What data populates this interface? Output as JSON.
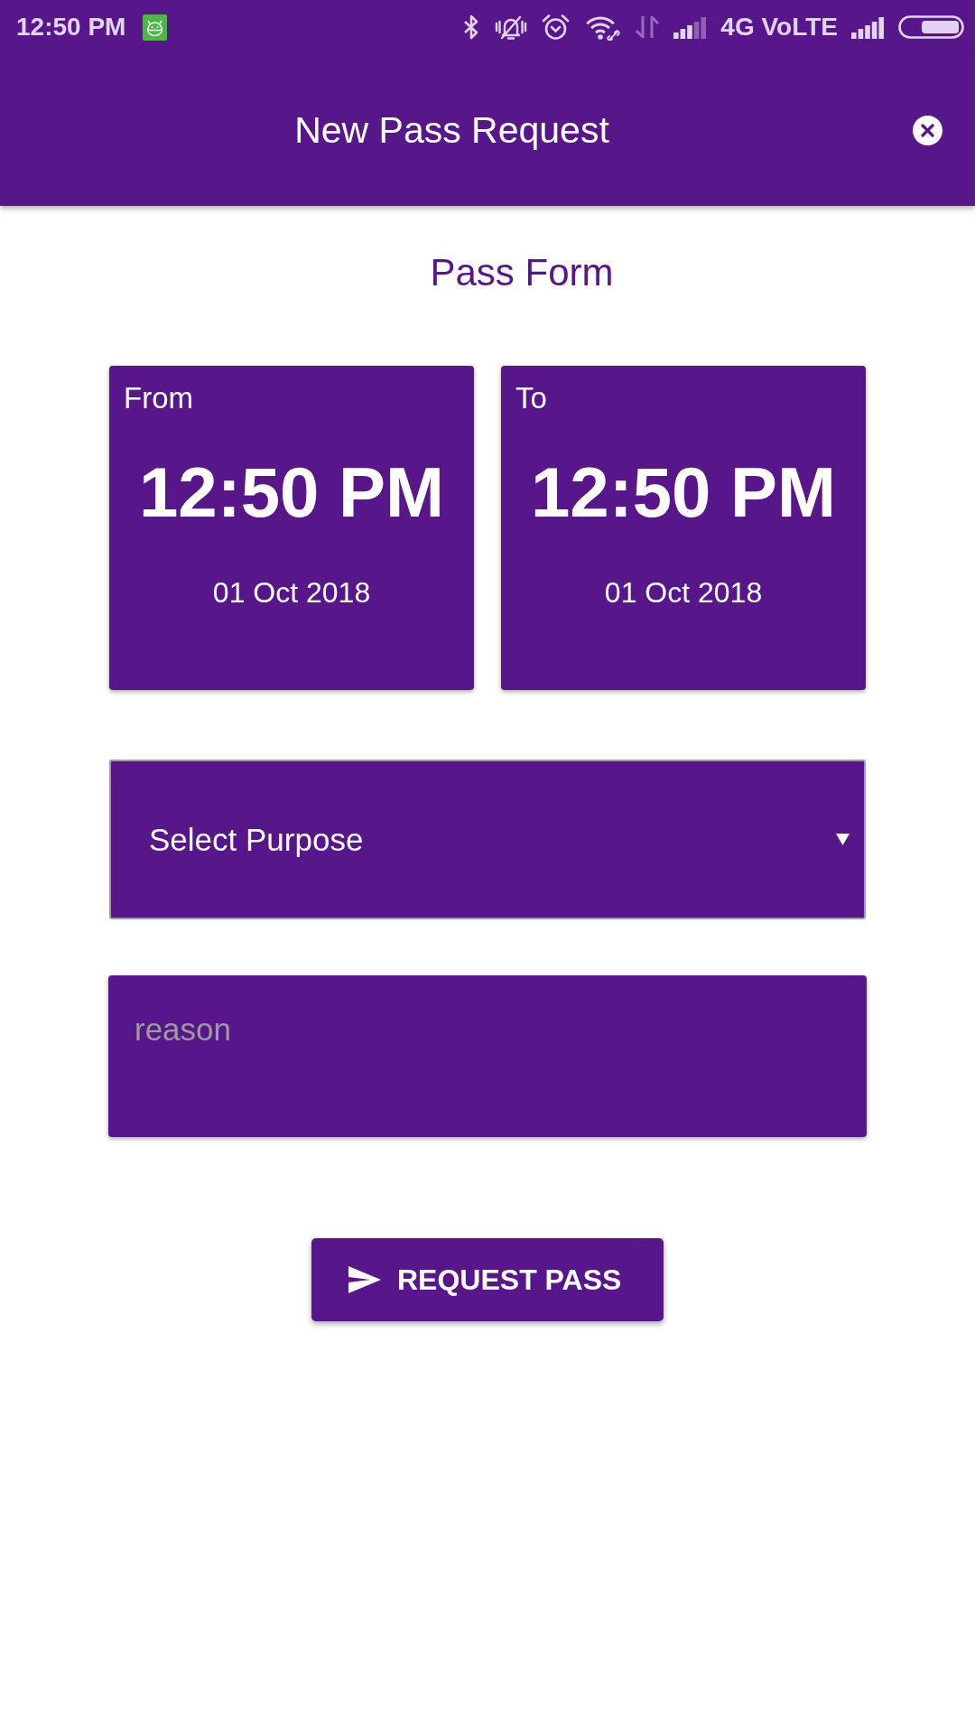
{
  "status_bar": {
    "time": "12:50 PM",
    "network": "4G VoLTE"
  },
  "header": {
    "title": "New Pass Request"
  },
  "form": {
    "title": "Pass Form",
    "time_cards": [
      {
        "label": "From",
        "time": "12:50 PM",
        "date": "01 Oct 2018"
      },
      {
        "label": "To",
        "time": "12:50 PM",
        "date": "01 Oct 2018"
      }
    ],
    "purpose_select": {
      "text": "Select Purpose"
    },
    "reason_field": {
      "placeholder": "reason"
    },
    "submit_button": {
      "label": "REQUEST PASS"
    }
  }
}
